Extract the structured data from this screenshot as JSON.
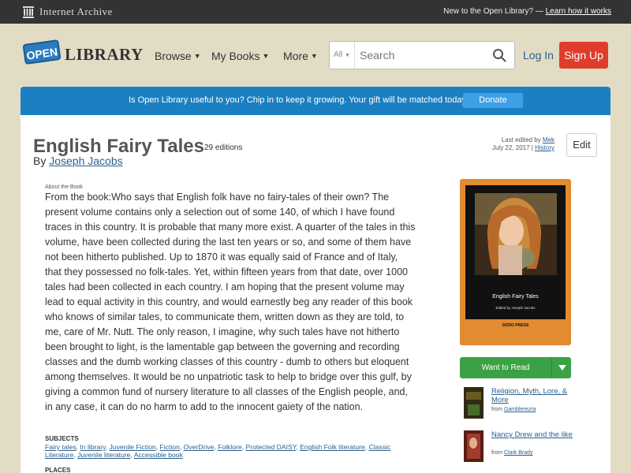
{
  "ia_bar": {
    "logo_text": "Internet Archive",
    "tagline": "New to the Open Library? —",
    "learn_link": "Learn how it works"
  },
  "header": {
    "logo_open": "OPEN",
    "logo_library": "LIBRARY",
    "nav": [
      "Browse",
      "My Books",
      "More"
    ],
    "search_category": "All",
    "search_placeholder": "Search",
    "login": "Log In",
    "signup": "Sign Up"
  },
  "banner": {
    "text": "Is Open Library useful to you? Chip in to keep it growing. Your gift will be matched today!",
    "donate": "Donate"
  },
  "book": {
    "title": "English Fairy Tales",
    "editions": "29 editions",
    "by": "By",
    "author": "Joseph Jacobs",
    "last_edited_prefix": "Last edited by",
    "last_edited_user": "Mek",
    "last_edited_date": "July 22, 2017 |",
    "history": "History",
    "edit": "Edit",
    "about_label": "About the Book",
    "description": "From the book:Who says that English folk have no fairy-tales of their own? The present volume contains only a selection out of some 140, of which I have found traces in this country. It is probable that many more exist. A quarter of the tales in this volume, have been collected during the last ten years or so, and some of them have not been hitherto published. Up to 1870 it was equally said of France and of Italy, that they possessed no folk-tales. Yet, within fifteen years from that date, over 1000 tales had been collected in each country. I am hoping that the present volume may lead to equal activity in this country, and would earnestly beg any reader of this book who knows of similar tales, to communicate them, written down as they are told, to me, care of Mr. Nutt. The only reason, I imagine, why such tales have not hitherto been brought to light, is the lamentable gap between the governing and recording classes and the dumb working classes of this country - dumb to others but eloquent among themselves. It would be no unpatriotic task to help to bridge over this gulf, by giving a common fund of nursery literature to all classes of the English people, and, in any case, it can do no harm to add to the innocent gaiety of the nation.",
    "subjects_label": "SUBJECTS",
    "subjects": [
      "Fairy tales",
      "In library",
      "Juvenile Fiction",
      "Fiction",
      "OverDrive",
      "Folklore",
      "Protected DAISY",
      "English Folk literature",
      "Classic Literature",
      "Juvenile literature",
      "Accessible book"
    ],
    "places_label": "PLACES"
  },
  "cover": {
    "title": "English Fairy Tales",
    "subtitle": "Edited by Joseph Jacobs",
    "publisher": "DODO PRESS"
  },
  "want_to_read": "Want to Read",
  "lists": [
    {
      "title": "Religion, Myth, Lore, & More",
      "from_prefix": "from",
      "from_user": "Gamblerezra"
    },
    {
      "title": "Nancy Drew and the like",
      "from_prefix": "from",
      "from_user": "Clark Brady"
    }
  ],
  "colors": {
    "accent_blue": "#1b80c2",
    "signup_red": "#e03c2b",
    "want_green": "#3ba145",
    "link": "#2a5f8d",
    "page_bg": "#e2dcc5"
  }
}
